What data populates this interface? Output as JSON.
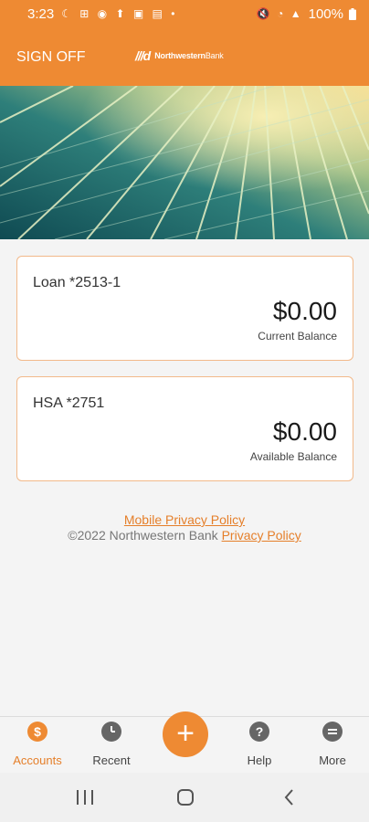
{
  "status_bar": {
    "time": "3:23",
    "notification_icons": "☾ ⊞ ◉ ⬆ ▣ ▤ •",
    "system_icons": "🔇 ◔ ▲",
    "battery": "100%"
  },
  "header": {
    "sign_off": "SIGN OFF",
    "logo_mark": "///d",
    "logo_bold": "Northwestern",
    "logo_light": "Bank"
  },
  "accounts": [
    {
      "name": "Loan *2513-1",
      "amount": "$0.00",
      "balance_label": "Current Balance"
    },
    {
      "name": "HSA *2751",
      "amount": "$0.00",
      "balance_label": "Available Balance"
    }
  ],
  "footer": {
    "mobile_privacy": "Mobile Privacy Policy",
    "copyright": "©2022 Northwestern Bank",
    "privacy_policy": "Privacy Policy"
  },
  "nav": {
    "accounts": "Accounts",
    "recent": "Recent",
    "add": "+",
    "help": "Help",
    "more": "More"
  },
  "colors": {
    "brand_orange": "#ee8a33",
    "card_border": "#f2b98a"
  }
}
